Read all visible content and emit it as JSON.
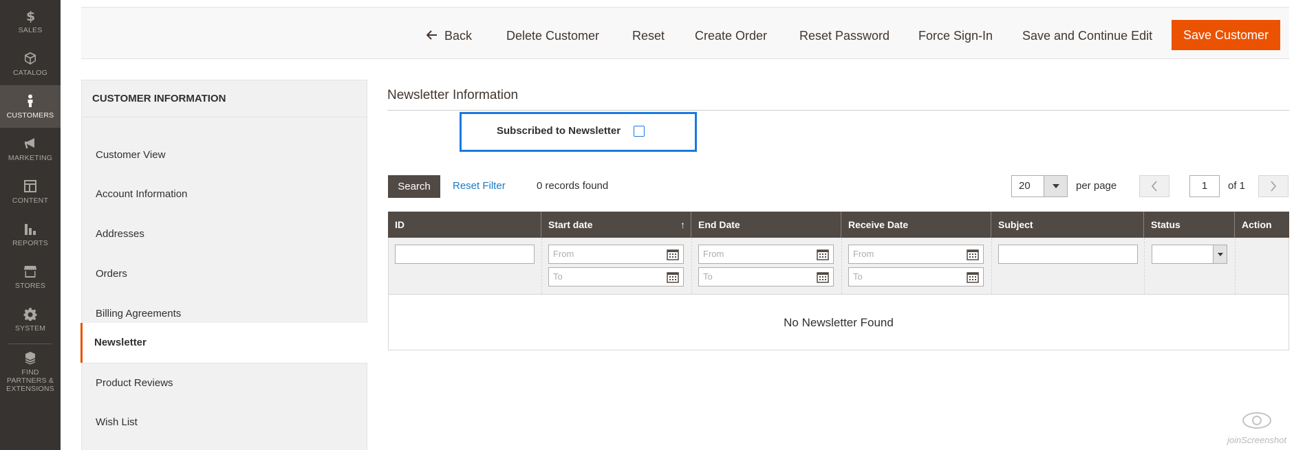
{
  "menu": {
    "items": [
      {
        "label": "SALES",
        "icon": "dollar-icon"
      },
      {
        "label": "CATALOG",
        "icon": "cube-icon"
      },
      {
        "label": "CUSTOMERS",
        "icon": "person-icon"
      },
      {
        "label": "MARKETING",
        "icon": "megaphone-icon"
      },
      {
        "label": "CONTENT",
        "icon": "layout-icon"
      },
      {
        "label": "REPORTS",
        "icon": "bar-chart-icon"
      },
      {
        "label": "STORES",
        "icon": "store-icon"
      },
      {
        "label": "SYSTEM",
        "icon": "gear-icon"
      },
      {
        "label": "FIND PARTNERS & EXTENSIONS",
        "icon": "boxes-icon"
      }
    ],
    "active_color": "#524d49"
  },
  "actions": {
    "back": "Back",
    "delete": "Delete Customer",
    "reset": "Reset",
    "create_order": "Create Order",
    "reset_password": "Reset Password",
    "force_signin": "Force Sign-In",
    "save_continue": "Save and Continue Edit",
    "save": "Save Customer",
    "save_color": "#eb5202"
  },
  "tabs": {
    "title": "CUSTOMER INFORMATION",
    "items": [
      {
        "label": "Customer View"
      },
      {
        "label": "Account Information"
      },
      {
        "label": "Addresses"
      },
      {
        "label": "Orders"
      },
      {
        "label": "Billing Agreements"
      },
      {
        "label": "Newsletter"
      },
      {
        "label": "Product Reviews"
      },
      {
        "label": "Wish List"
      }
    ],
    "active": "Newsletter"
  },
  "newsletter": {
    "title": "Newsletter Information",
    "subscribed_label": "Subscribed to Newsletter",
    "subscribed": false,
    "highlight_color": "#1979e0"
  },
  "toolbar": {
    "search": "Search",
    "reset_filter": "Reset Filter",
    "records": "0 records found",
    "per_page_value": "20",
    "per_page_label": "per page",
    "page_value": "1",
    "of_pages": "of 1"
  },
  "grid": {
    "columns": [
      "ID",
      "Start date",
      "End Date",
      "Receive Date",
      "Subject",
      "Status",
      "Action"
    ],
    "sort_arrow": "↑",
    "from_placeholder": "From",
    "to_placeholder": "To",
    "empty": "No Newsletter Found",
    "header_color": "#514943"
  },
  "watermark": "joinScreenshot"
}
